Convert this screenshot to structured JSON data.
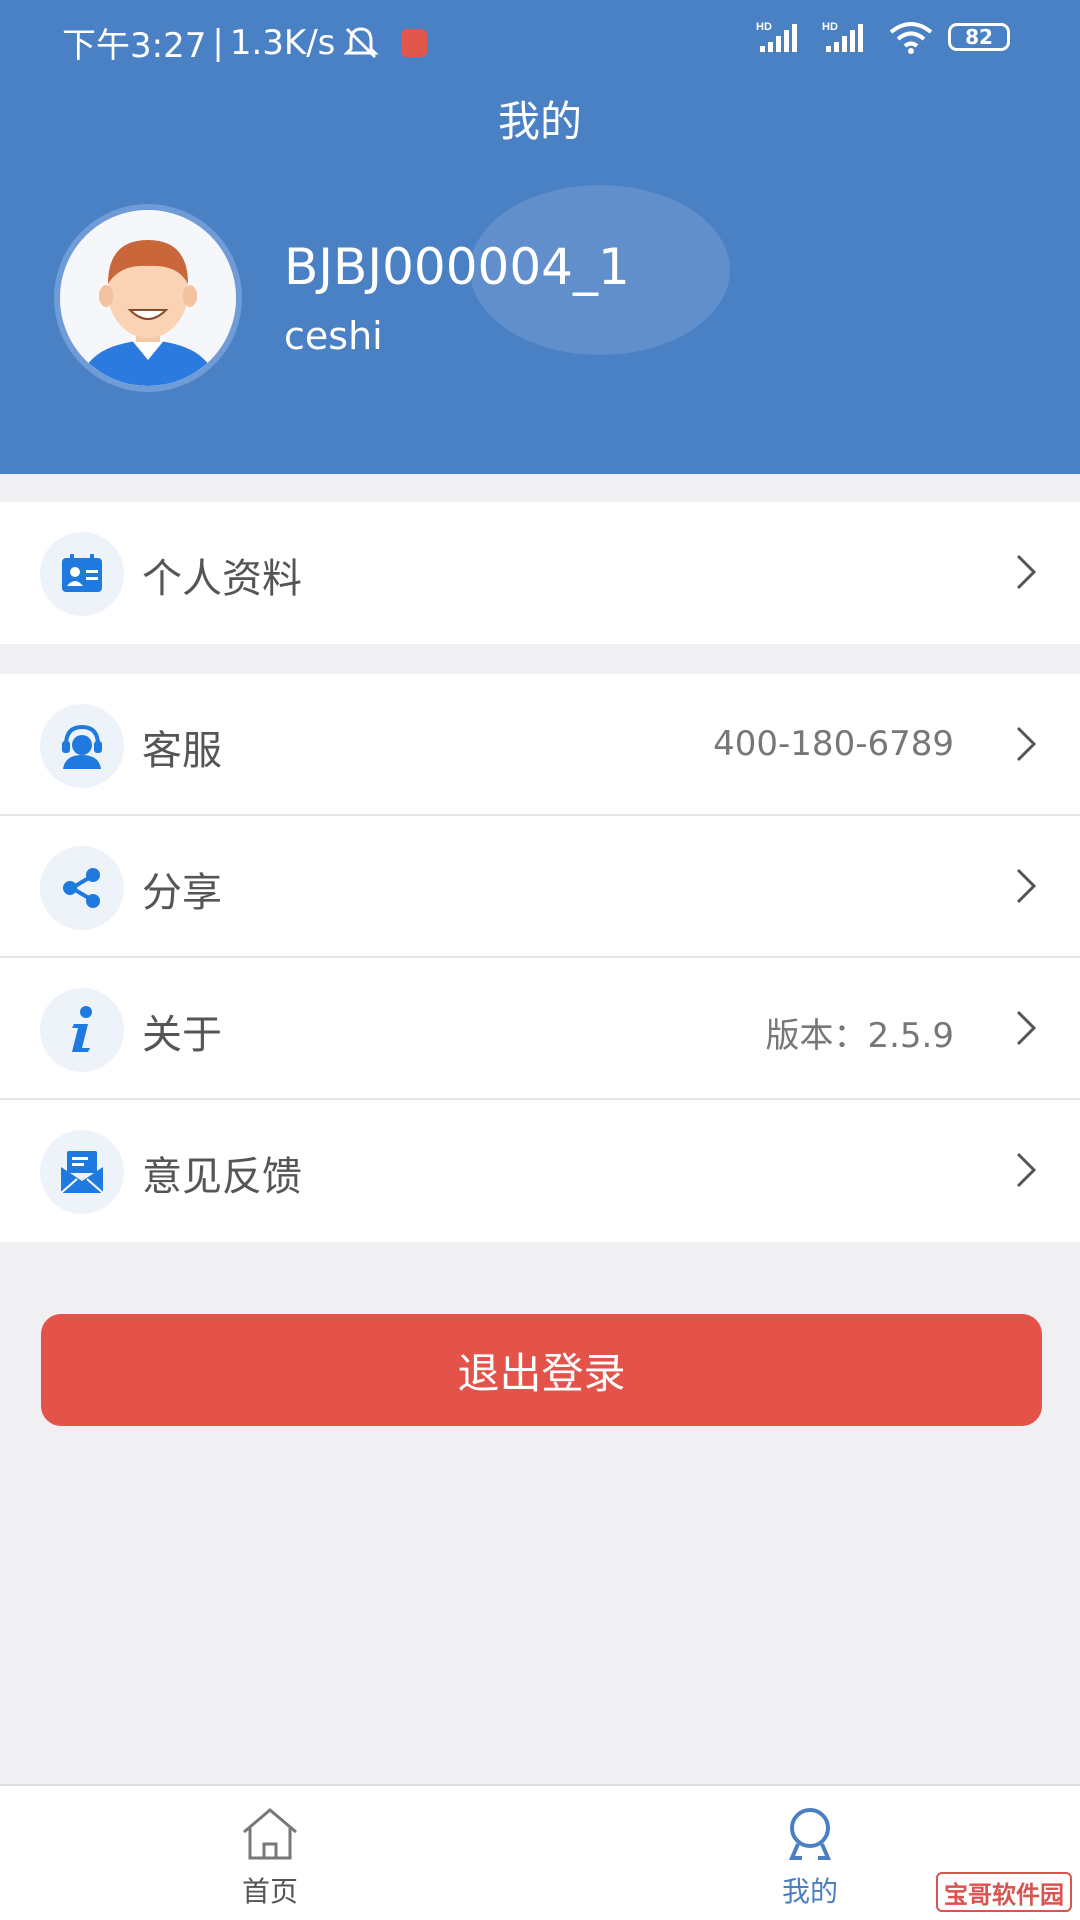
{
  "status_bar": {
    "time": "下午3:27",
    "separator": "|",
    "net_speed": "1.3K/s",
    "network_1": "HD",
    "network_2": "HD",
    "battery": "82"
  },
  "header": {
    "title": "我的"
  },
  "profile": {
    "account_id": "BJBJ000004_1",
    "username": "ceshi"
  },
  "menu": {
    "group1": [
      {
        "label": "个人资料",
        "value": "",
        "icon": "id-card-icon"
      }
    ],
    "group2": [
      {
        "label": "客服",
        "value": "400-180-6789",
        "icon": "customer-service-icon"
      },
      {
        "label": "分享",
        "value": "",
        "icon": "share-icon"
      },
      {
        "label": "关于",
        "value": "版本：2.5.9",
        "icon": "info-icon"
      },
      {
        "label": "意见反馈",
        "value": "",
        "icon": "envelope-icon"
      }
    ]
  },
  "logout_label": "退出登录",
  "tabbar": {
    "home_label": "首页",
    "mine_label": "我的"
  },
  "watermark": "宝哥软件园",
  "colors": {
    "header_bg": "#4a80c4",
    "logout_bg": "#e4534a",
    "icon_blue": "#1f7ae0",
    "active_tab": "#4a7fc3"
  }
}
